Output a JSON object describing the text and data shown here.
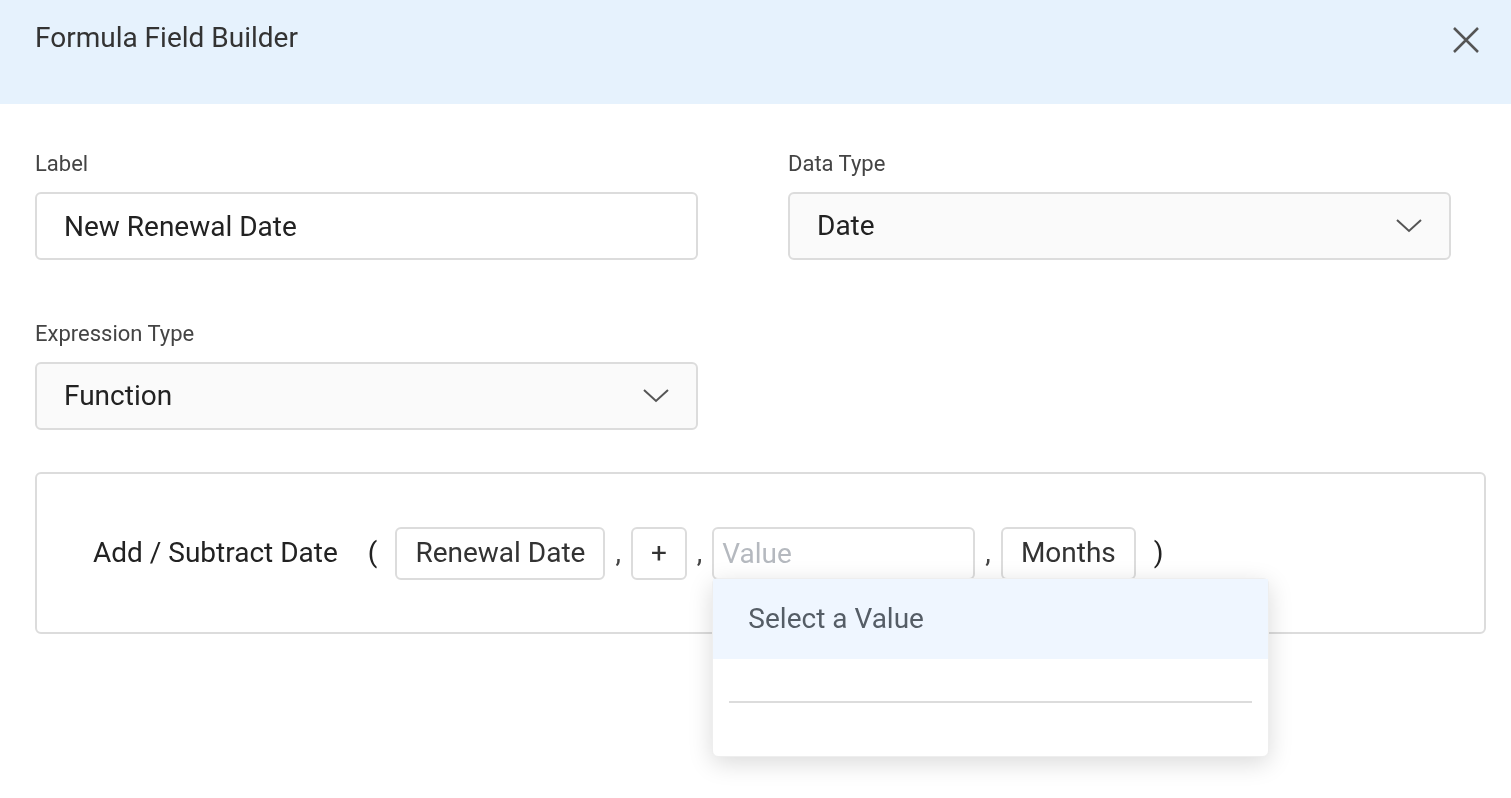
{
  "dialog": {
    "title": "Formula Field Builder"
  },
  "fields": [
    {
      "label": "Label",
      "kind": "text",
      "value": "New Renewal Date"
    },
    {
      "label": "Data Type",
      "kind": "select",
      "value": "Date"
    },
    {
      "label": "Expression Type",
      "kind": "select",
      "value": "Function"
    }
  ],
  "formula": {
    "function": "Add / Subtract Date",
    "open_paren": "(",
    "close_paren": ")",
    "tokens": [
      {
        "kind": "chip",
        "text": "Renewal Date"
      },
      {
        "kind": "separator",
        "text": ","
      },
      {
        "kind": "chip",
        "text": "+"
      },
      {
        "kind": "separator",
        "text": ","
      },
      {
        "kind": "input",
        "placeholder": "Value"
      },
      {
        "kind": "separator",
        "text": ","
      },
      {
        "kind": "chip",
        "text": "Months"
      }
    ]
  },
  "dropdown": {
    "options": [
      {
        "text": "Select a Value",
        "selected": true
      }
    ]
  }
}
